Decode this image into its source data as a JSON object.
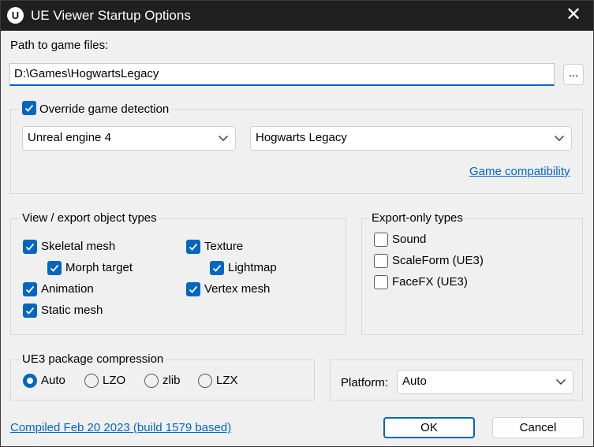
{
  "window": {
    "title": "UE Viewer Startup Options",
    "icon_letter": "U",
    "close_glyph": "✕"
  },
  "path": {
    "label": "Path to game files:",
    "value": "D:\\Games\\HogwartsLegacy",
    "browse_label": "..."
  },
  "detection": {
    "override_label": "Override game detection",
    "override_checked": true,
    "engine": "Unreal engine 4",
    "game": "Hogwarts Legacy",
    "compat_link": "Game compatibility"
  },
  "object_types": {
    "title": "View / export object types",
    "skeletal_mesh": {
      "label": "Skeletal mesh",
      "checked": true
    },
    "morph_target": {
      "label": "Morph target",
      "checked": true
    },
    "animation": {
      "label": "Animation",
      "checked": true
    },
    "static_mesh": {
      "label": "Static mesh",
      "checked": true
    },
    "texture": {
      "label": "Texture",
      "checked": true
    },
    "lightmap": {
      "label": "Lightmap",
      "checked": true
    },
    "vertex_mesh": {
      "label": "Vertex mesh",
      "checked": true
    }
  },
  "export_only": {
    "title": "Export-only types",
    "sound": {
      "label": "Sound",
      "checked": false
    },
    "scaleform": {
      "label": "ScaleForm (UE3)",
      "checked": false
    },
    "facefx": {
      "label": "FaceFX (UE3)",
      "checked": false
    }
  },
  "compression": {
    "title": "UE3 package compression",
    "selected": "Auto",
    "options": [
      "Auto",
      "LZO",
      "zlib",
      "LZX"
    ]
  },
  "platform": {
    "label": "Platform:",
    "value": "Auto"
  },
  "footer": {
    "build_link": "Compiled Feb 20 2023 (build 1579 based)",
    "ok_label": "OK",
    "cancel_label": "Cancel"
  },
  "colors": {
    "accent": "#0067c0",
    "titlebar": "#202020",
    "dialog_bg": "#f0f0f0",
    "link": "#0066cc"
  }
}
